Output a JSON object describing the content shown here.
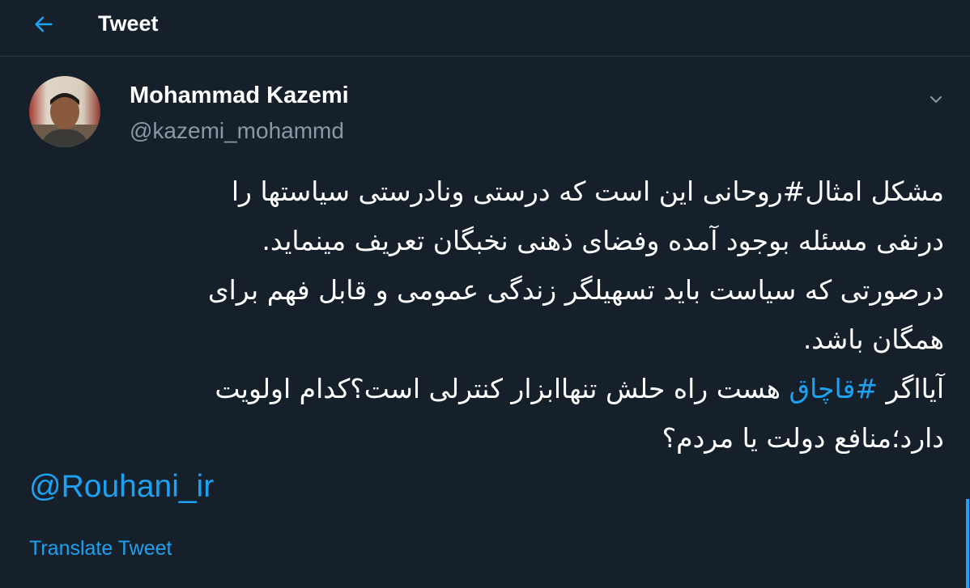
{
  "header": {
    "title": "Tweet",
    "back_icon": "arrow-left-icon"
  },
  "tweet": {
    "author": {
      "display_name": "Mohammad Kazemi",
      "handle": "@kazemi_mohammd"
    },
    "menu_icon": "chevron-down-icon",
    "text": {
      "line1": "مشکل امثال#روحانی این است که درستی ونادرستی سیاستها را",
      "line2": "درنفی مسئله بوجود آمده وفضای ذهنی نخبگان تعریف مینماید.",
      "line3": "درصورتی که سیاست باید تسهیلگر زندگی عمومی و قابل فهم برای",
      "line4": "همگان باشد.",
      "line5_start": "آیااگر ",
      "line5_hashtag": "#قاچاق",
      "line5_end": " هست راه حلش تنهاابزار کنترلی است؟کدام اولویت",
      "line6": "دارد؛منافع دولت یا مردم؟"
    },
    "mention": "@Rouhani_ir",
    "translate_label": "Translate Tweet"
  },
  "colors": {
    "background": "#15202b",
    "accent": "#1da1f2",
    "secondary_text": "#8899a6"
  }
}
